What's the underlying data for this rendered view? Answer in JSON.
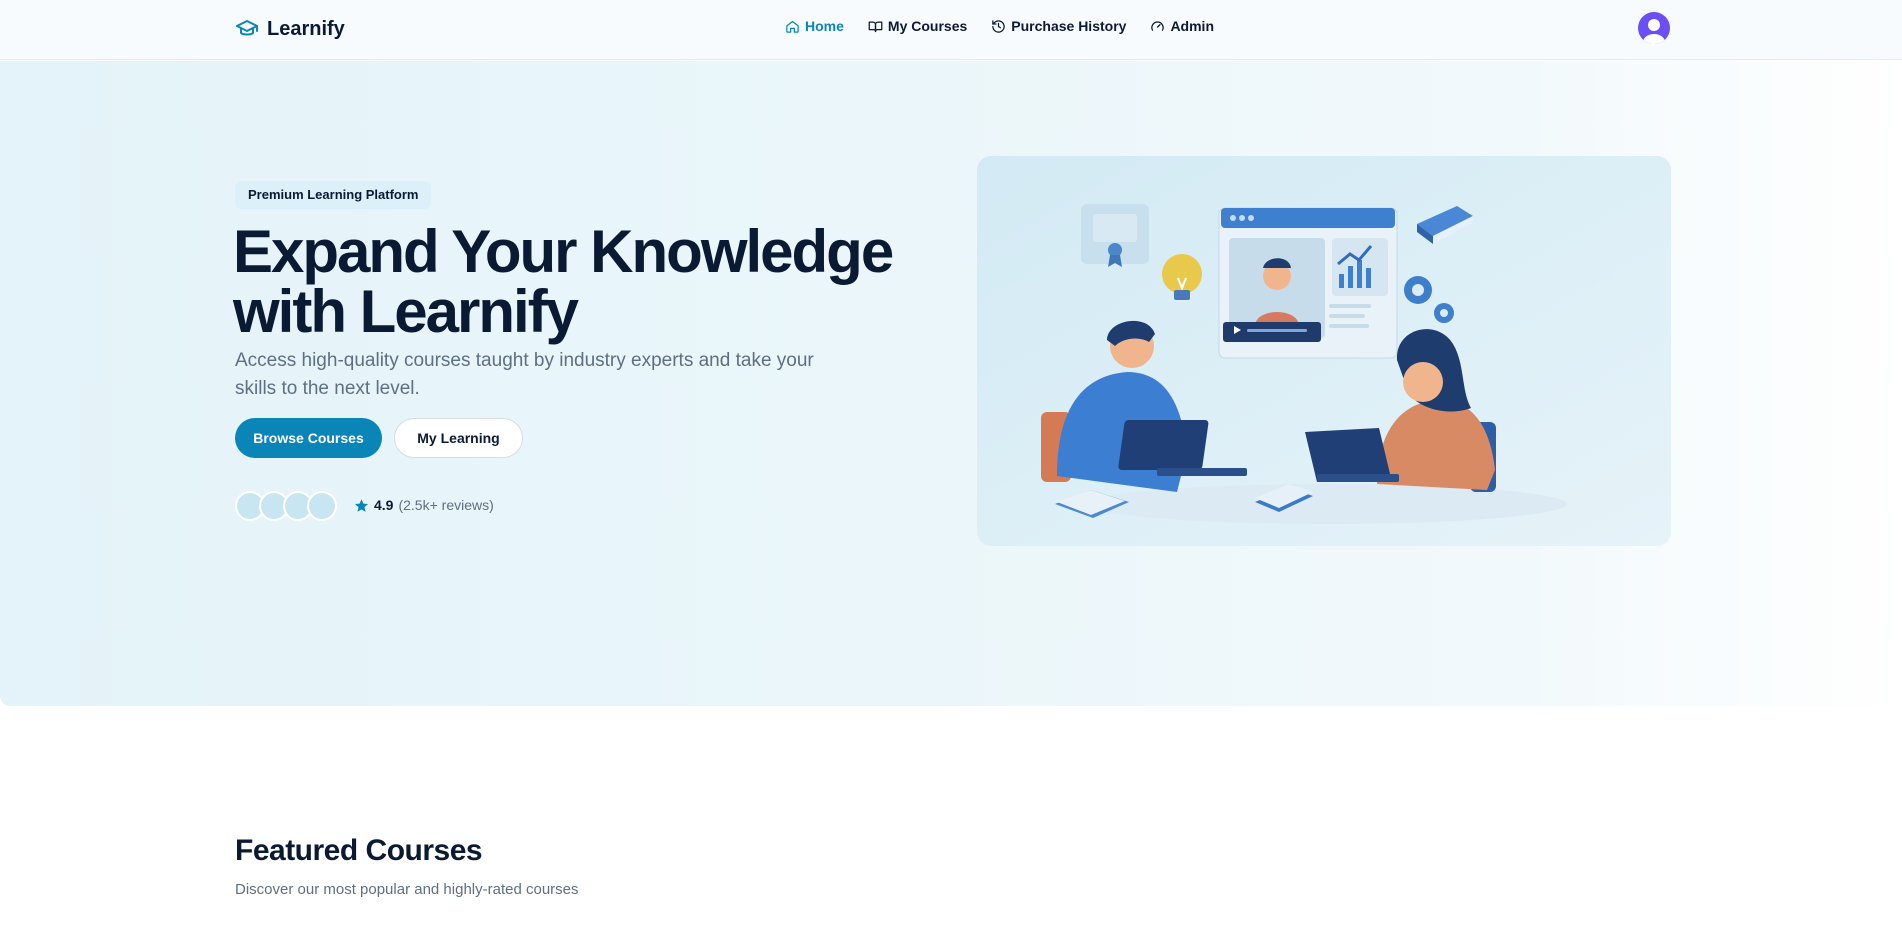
{
  "nav": {
    "brand": "Learnify",
    "links": [
      {
        "label": "Home",
        "icon": "home-icon",
        "active": true
      },
      {
        "label": "My Courses",
        "icon": "book-open-icon",
        "active": false
      },
      {
        "label": "Purchase History",
        "icon": "history-icon",
        "active": false
      },
      {
        "label": "Admin",
        "icon": "gauge-icon",
        "active": false
      }
    ],
    "avatar_icon": "user-avatar-icon"
  },
  "hero": {
    "badge": "Premium Learning Platform",
    "title_line1": "Expand Your Knowledge",
    "title_line2": "with Learnify",
    "subtitle": "Access high-quality courses taught by industry experts and take your skills to the next level.",
    "primary_button": "Browse Courses",
    "secondary_button": "My Learning",
    "rating": "4.9",
    "reviews": "(2.5k+ reviews)",
    "illustration": "online-learning-illustration"
  },
  "featured": {
    "title": "Featured Courses",
    "subtitle": "Discover our most popular and highly-rated courses"
  },
  "colors": {
    "accent": "#0a85b8",
    "text": "#0b1a33",
    "muted": "#5e6f82",
    "avatar": "#6b4ff5",
    "star": "#0a85b8"
  }
}
